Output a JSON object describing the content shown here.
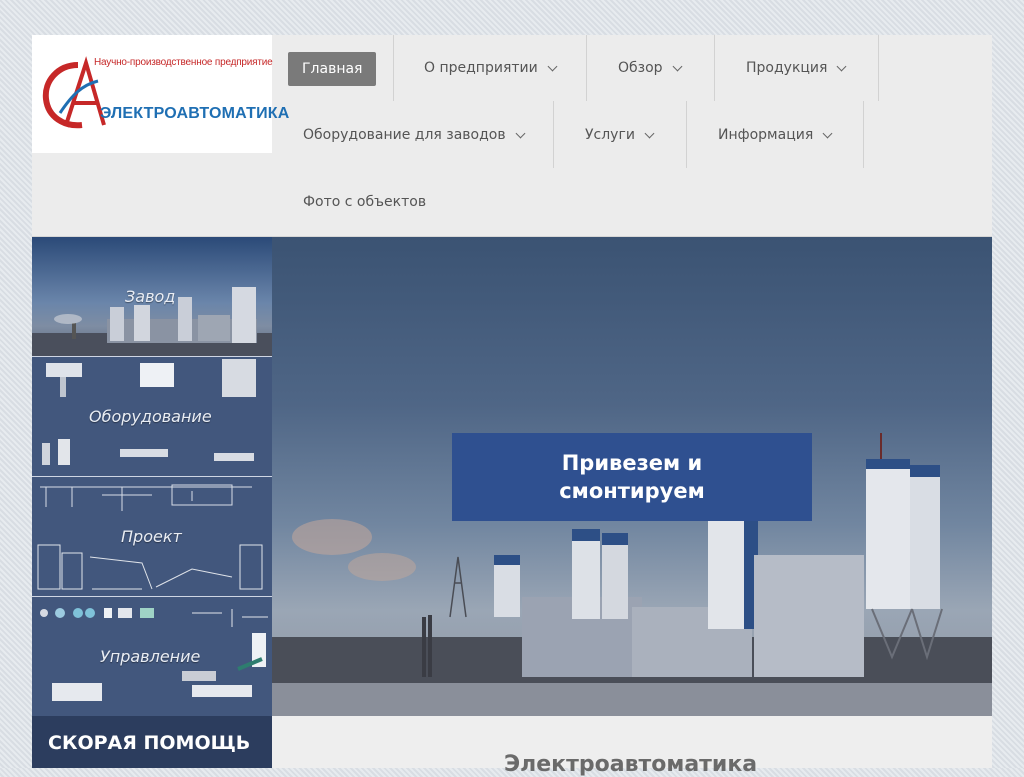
{
  "logo": {
    "tagline": "Научно-производственное предприятие",
    "brand": "ЭЛЕКТРОАВТОМАТИКА"
  },
  "nav": {
    "items": [
      {
        "label": "Главная",
        "active": true
      },
      {
        "label": "О предприятии",
        "dropdown": true
      },
      {
        "label": "Обзор",
        "dropdown": true
      },
      {
        "label": "Продукция",
        "dropdown": true
      },
      {
        "label": "Оборудование для заводов",
        "dropdown": true
      },
      {
        "label": "Услуги",
        "dropdown": true
      },
      {
        "label": "Информация",
        "dropdown": true
      },
      {
        "label": "Фото с объектов"
      }
    ]
  },
  "sidebar": {
    "tiles": [
      {
        "label": "Завод"
      },
      {
        "label": "Оборудование"
      },
      {
        "label": "Проект"
      },
      {
        "label": "Управление"
      }
    ],
    "help_label": "СКОРАЯ ПОМОЩЬ"
  },
  "hero": {
    "caption": "Привезем и\nсмонтируем"
  },
  "content": {
    "heading": "Электроавтоматика"
  },
  "colors": {
    "nav_active_bg": "#7a7a7a",
    "hero_caption_bg": "#2f5090",
    "sidebar_tile_bg": "#42577d",
    "help_bg": "#2c3d5e",
    "brand_blue": "#1f6fb3",
    "brand_red": "#c62828"
  }
}
